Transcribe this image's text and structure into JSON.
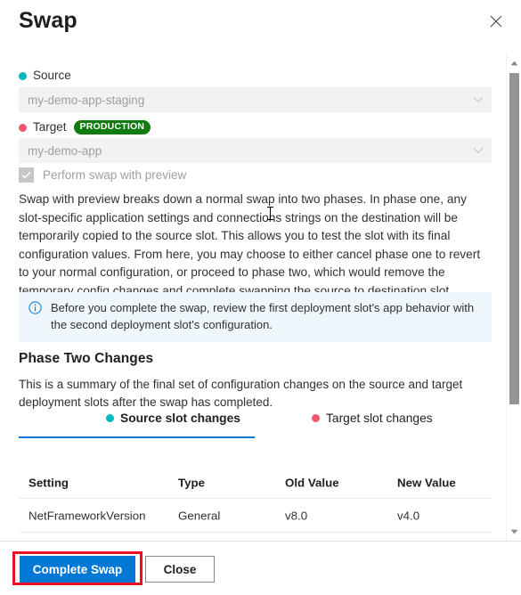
{
  "header": {
    "title": "Swap",
    "close_icon": "close-icon"
  },
  "colors": {
    "source_dot": "#00b7c3",
    "target_dot": "#f2576d",
    "production_badge_bg": "#107c10",
    "accent_blue": "#0078d4",
    "info_bg": "#eff6fc",
    "highlight_red": "#e81123"
  },
  "form": {
    "source": {
      "label": "Source",
      "dot_icon": "source-dot-icon",
      "value": "my-demo-app-staging",
      "chevron_icon": "chevron-down-icon"
    },
    "target": {
      "label": "Target",
      "dot_icon": "target-dot-icon",
      "badge": "PRODUCTION",
      "value": "my-demo-app",
      "chevron_icon": "chevron-down-icon"
    },
    "preview_checkbox": {
      "label": "Perform swap with preview",
      "checked": true,
      "disabled": true,
      "check_icon": "checkmark-icon"
    }
  },
  "description": "Swap with preview breaks down a normal swap into two phases. In phase one, any slot-specific application settings and connections strings on the destination will be temporarily copied to the source slot. This allows you to test the slot with its final configuration values. From here, you may choose to either cancel phase one to revert to your normal configuration, or proceed to phase two, which would remove the temporary config changes and complete swapping the source to destination slot.",
  "info_banner": {
    "icon": "info-circle-icon",
    "text": "Before you complete the swap, review the first deployment slot's app behavior with the second deployment slot's configuration."
  },
  "phase_two": {
    "heading": "Phase Two Changes",
    "subtext": "This is a summary of the final set of configuration changes on the source and target deployment slots after the swap has completed.",
    "tabs": [
      {
        "label": "Source slot changes",
        "dot_icon": "source-dot-icon",
        "active": true
      },
      {
        "label": "Target slot changes",
        "dot_icon": "target-dot-icon",
        "active": false
      }
    ]
  },
  "table": {
    "columns": [
      "Setting",
      "Type",
      "Old Value",
      "New Value"
    ],
    "rows": [
      [
        "NetFrameworkVersion",
        "General",
        "v8.0",
        "v4.0"
      ]
    ]
  },
  "footer": {
    "primary_button": "Complete Swap",
    "secondary_button": "Close"
  },
  "scrollbar": {
    "up_icon": "scroll-up-arrow-icon",
    "down_icon": "scroll-down-arrow-icon",
    "thumb": "scrollbar-thumb"
  }
}
